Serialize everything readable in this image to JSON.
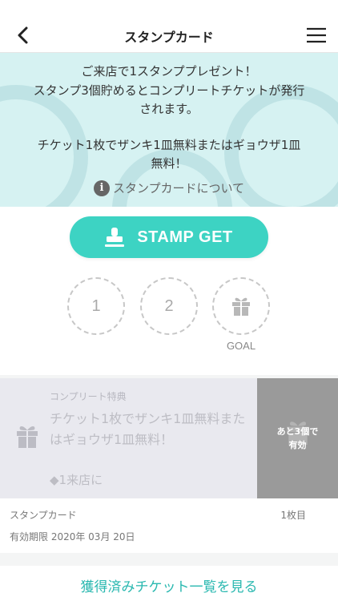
{
  "nav": {
    "title": "スタンプカード",
    "back_icon": "chevron-left-icon",
    "menu_icon": "hamburger-menu-icon"
  },
  "info": {
    "line1": "ご来店で1スタンププレゼント！",
    "line2": "スタンプ3個貯めるとコンプリートチケットが発行",
    "line3": "されます。",
    "line4": "チケット1枚でザンキ1皿無料またはギョウザ1皿",
    "line5": "無料！",
    "link_label": "スタンプカードについて",
    "link_icon": "info-icon"
  },
  "stamp": {
    "button_label": "STAMP GET",
    "button_icon": "stamp-icon",
    "slots": [
      "1",
      "2"
    ],
    "goal_icon": "gift-icon",
    "goal_label": "GOAL"
  },
  "ticket": {
    "heading": "コンプリート特典",
    "description": "チケット1枚でザンキ1皿無料またはギョウザ1皿無料！",
    "condition": "◆1来店に",
    "side_line1": "あと3個で",
    "side_line2": "有効",
    "card_label": "スタンプカード",
    "count_label": "1枚目",
    "expiry": "有効期限 2020年 03月 20日"
  },
  "footer": {
    "link_label": "獲得済みチケット一覧を見る"
  },
  "colors": {
    "accent": "#3dd3c3",
    "banner_bg": "#d6f2f2",
    "link": "#2ab8b0",
    "ticket_side": "#9a9a9a"
  }
}
